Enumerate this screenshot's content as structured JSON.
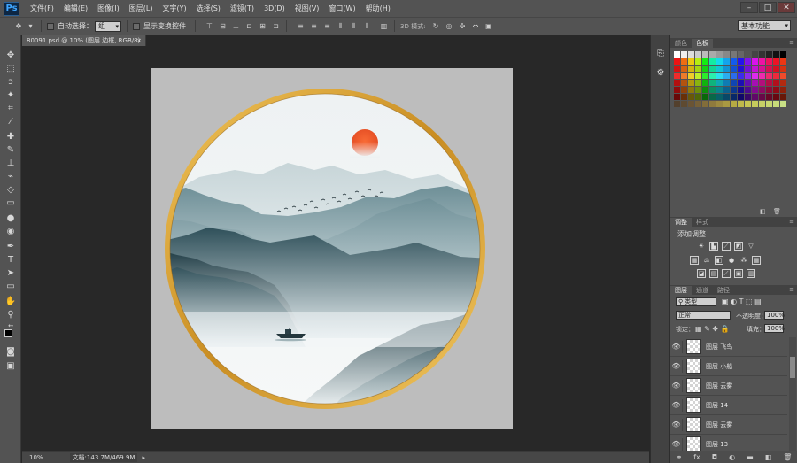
{
  "app": {
    "logo": "Ps"
  },
  "menubar": {
    "items": [
      "文件(F)",
      "编辑(E)",
      "图像(I)",
      "图层(L)",
      "文字(Y)",
      "选择(S)",
      "滤镜(T)",
      "3D(D)",
      "视图(V)",
      "窗口(W)",
      "帮助(H)"
    ]
  },
  "window_controls": {
    "minimize": "–",
    "maximize": "□",
    "close": "✕"
  },
  "options_bar": {
    "auto_select_label": "自动选择：",
    "auto_select_value": "组",
    "show_transform_label": "显示变换控件",
    "mode_3d_label": "3D 模式:",
    "workspace_value": "基本功能"
  },
  "document": {
    "tab_title": "80091.psd @ 10% (图层 边框, RGB/8)",
    "tab_close": "×"
  },
  "statusbar": {
    "zoom": "10%",
    "doc_info": "文档:143.7M/469.9M"
  },
  "panels": {
    "color_tabs": [
      "颜色",
      "色板"
    ],
    "adjust_tabs": [
      "调整",
      "样式"
    ],
    "adjust_title": "添加调整",
    "layers_tabs": [
      "图层",
      "通道",
      "路径"
    ],
    "filter_kind": "类型",
    "blend_mode": "正常",
    "opacity_label": "不透明度：",
    "opacity_value": "100%",
    "lock_label": "锁定：",
    "fill_label": "填充：",
    "fill_value": "100%",
    "layers": [
      {
        "name": "图层 飞鸟"
      },
      {
        "name": "图层 小船"
      },
      {
        "name": "图层 云雾"
      },
      {
        "name": "图层 14"
      },
      {
        "name": "图层 云雾"
      },
      {
        "name": "图层 13"
      }
    ]
  },
  "colors": {
    "ui_dark": "#282828",
    "ui_panel": "#535353",
    "frame_gold": "#d6a23a",
    "sun": "#ec5a2d",
    "mountain_dark": "#2f4f58"
  }
}
